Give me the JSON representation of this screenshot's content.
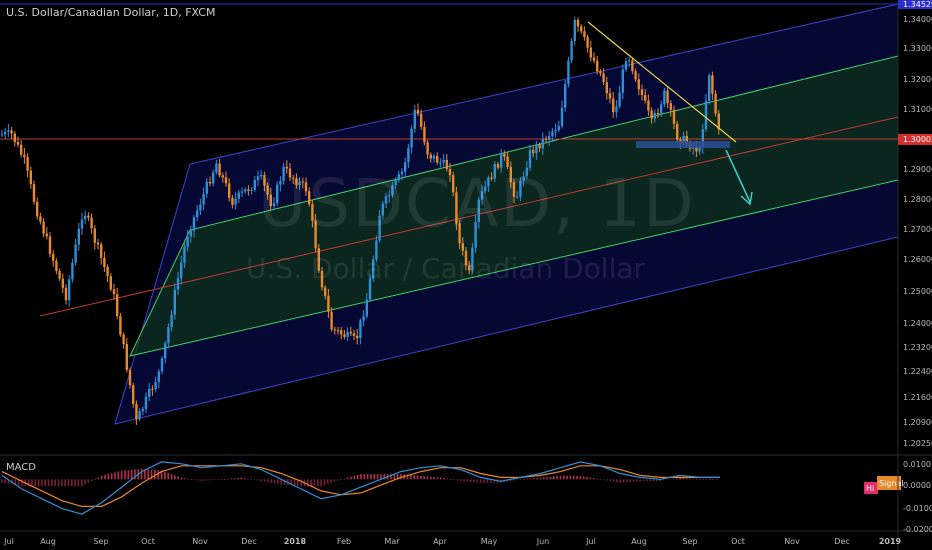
{
  "chart_title": "U.S. Dollar/Canadian Dollar, 1D, FXCM",
  "watermark": {
    "symbol": "USDCAD, 1D",
    "description": "U.S. Dollar / Canadian Dollar"
  },
  "colors": {
    "background": "#000000",
    "candle_up": "#2f8fd8",
    "candle_down": "#e8892b",
    "outer_channel_fill": "#0b0f5e",
    "outer_channel_line": "#3a45c8",
    "inner_channel_fill": "#0d3a12",
    "inner_channel_line": "#45d165",
    "median_line": "#c0392b",
    "resistance_line": "#c0392b",
    "trend_line": "#e8d44d",
    "support_zone": "#2a4f9a",
    "projection_arrow": "#3fd0c0",
    "macd_line": "#2f8fd8",
    "signal_line": "#e8892b",
    "hist_positive": "#b5304f",
    "hist_negative": "#7a1e3a",
    "current_price_tag": "#d32f2f",
    "top_price_tag": "#2d2dcc",
    "hist_tag": "#e0306a",
    "signal_tag": "#e8892b"
  },
  "chart_data": [
    {
      "type": "candlestick",
      "title": "U.S. Dollar/Canadian Dollar, 1D, FXCM",
      "x_axis_labels": [
        "Jul",
        "Aug",
        "Sep",
        "Oct",
        "Nov",
        "Dec",
        "2018",
        "Feb",
        "Mar",
        "Apr",
        "May",
        "Jun",
        "Jul",
        "Aug",
        "Sep",
        "Oct",
        "Nov",
        "Dec",
        "2019"
      ],
      "y_axis_labels": [
        "1.34000",
        "1.33000",
        "1.32000",
        "1.31000",
        "1.29000",
        "1.28000",
        "1.27000",
        "1.26000",
        "1.25000",
        "1.24000",
        "1.23200",
        "1.22400",
        "1.21600",
        "1.20900",
        "1.20250"
      ],
      "ylim": [
        1.2,
        1.345
      ],
      "price_tags": {
        "top": "1.34529",
        "current": "1.30002"
      },
      "reference_levels": {
        "horizontal_line": 1.30002,
        "top_line": 1.34529
      },
      "swing_points": [
        [
          "Jul",
          1.3015
        ],
        [
          "Jul",
          1.293
        ],
        [
          "Jul",
          1.277
        ],
        [
          "Aug",
          1.248
        ],
        [
          "Aug",
          1.277
        ],
        [
          "Sep",
          1.25
        ],
        [
          "Sep",
          1.23
        ],
        [
          "Sep",
          1.209
        ],
        [
          "Oct",
          1.225
        ],
        [
          "Oct",
          1.248
        ],
        [
          "Oct",
          1.268
        ],
        [
          "Nov",
          1.292
        ],
        [
          "Nov",
          1.279
        ],
        [
          "Dec",
          1.287
        ],
        [
          "Dec",
          1.278
        ],
        [
          "Dec",
          1.29
        ],
        [
          "2018",
          1.283
        ],
        [
          "2018",
          1.256
        ],
        [
          "2018",
          1.238
        ],
        [
          "Feb",
          1.234
        ],
        [
          "Feb",
          1.249
        ],
        [
          "Feb",
          1.276
        ],
        [
          "Mar",
          1.29
        ],
        [
          "Mar",
          1.311
        ],
        [
          "Mar",
          1.295
        ],
        [
          "Apr",
          1.29
        ],
        [
          "Apr",
          1.265
        ],
        [
          "Apr",
          1.255
        ],
        [
          "Apr",
          1.28
        ],
        [
          "May",
          1.295
        ],
        [
          "May",
          1.28
        ],
        [
          "May",
          1.295
        ],
        [
          "Jun",
          1.305
        ],
        [
          "Jun",
          1.339
        ],
        [
          "Jul",
          1.32
        ],
        [
          "Jul",
          1.308
        ],
        [
          "Jul",
          1.329
        ],
        [
          "Aug",
          1.305
        ],
        [
          "Aug",
          1.315
        ],
        [
          "Aug",
          1.301
        ],
        [
          "Sep",
          1.296
        ],
        [
          "Sep",
          1.322
        ],
        [
          "Sep",
          1.302
        ],
        [
          "Sep",
          1.3
        ]
      ],
      "annotations": {
        "trend_line": [
          [
            "Jun",
            1.339
          ],
          [
            "Sep",
            1.3
          ]
        ],
        "projection": {
          "from": 1.299,
          "to": 1.281
        }
      }
    },
    {
      "type": "macd",
      "title": "MACD",
      "y_axis_labels": [
        "0.0100",
        "0.0000",
        "-0.0100",
        "-0.0200"
      ],
      "ylim": [
        -0.021,
        0.011
      ],
      "tag_labels": {
        "signal": "Signal",
        "histogram": "Hi"
      },
      "macd_line": [
        0.002,
        -0.005,
        -0.01,
        -0.015,
        -0.018,
        -0.012,
        -0.004,
        0.004,
        0.009,
        0.008,
        0.006,
        0.007,
        0.008,
        0.005,
        0.0,
        -0.005,
        -0.01,
        -0.008,
        -0.004,
        0.0,
        0.004,
        0.006,
        0.007,
        0.005,
        0.001,
        -0.001,
        0.001,
        0.003,
        0.006,
        0.009,
        0.007,
        0.003,
        0.001,
        0.0,
        0.002,
        0.001,
        0.001
      ],
      "signal_line": [
        0.004,
        -0.001,
        -0.006,
        -0.011,
        -0.014,
        -0.014,
        -0.009,
        -0.002,
        0.004,
        0.007,
        0.007,
        0.007,
        0.007,
        0.006,
        0.003,
        -0.001,
        -0.006,
        -0.008,
        -0.007,
        -0.003,
        0.001,
        0.004,
        0.006,
        0.006,
        0.003,
        0.001,
        0.001,
        0.002,
        0.004,
        0.007,
        0.007,
        0.005,
        0.002,
        0.001,
        0.001,
        0.001,
        0.001
      ]
    }
  ]
}
